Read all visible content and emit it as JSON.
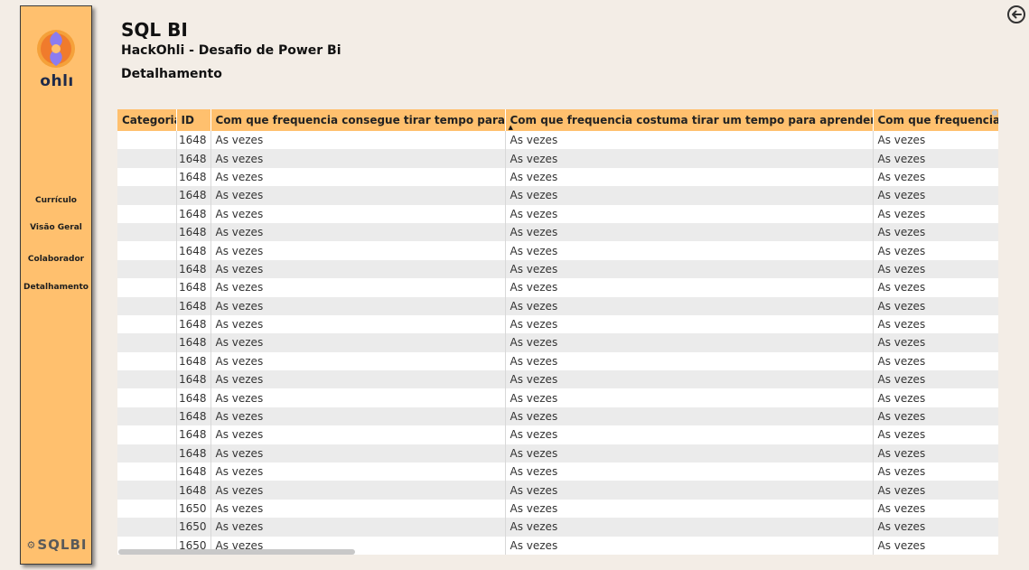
{
  "sidebar": {
    "logo_text": "ohlı",
    "nav": [
      "Currículo",
      "Visão Geral",
      "Colaborador",
      "Detalhamento"
    ],
    "brand": "SQLBI"
  },
  "header": {
    "title": "SQL BI",
    "subtitle": "HackOhli - Desafio de Power Bi",
    "section": "Detalhamento"
  },
  "table": {
    "columns": [
      "Categoria",
      "ID",
      "Com que frequencia consegue tirar tempo para hobbies?",
      "Com que frequencia costuma tirar um tempo para aprender algo novo?",
      "Com que frequencia vo"
    ],
    "rows": [
      [
        "",
        "1648",
        "As vezes",
        "As vezes",
        "As vezes"
      ],
      [
        "",
        "1648",
        "As vezes",
        "As vezes",
        "As vezes"
      ],
      [
        "",
        "1648",
        "As vezes",
        "As vezes",
        "As vezes"
      ],
      [
        "",
        "1648",
        "As vezes",
        "As vezes",
        "As vezes"
      ],
      [
        "",
        "1648",
        "As vezes",
        "As vezes",
        "As vezes"
      ],
      [
        "",
        "1648",
        "As vezes",
        "As vezes",
        "As vezes"
      ],
      [
        "",
        "1648",
        "As vezes",
        "As vezes",
        "As vezes"
      ],
      [
        "",
        "1648",
        "As vezes",
        "As vezes",
        "As vezes"
      ],
      [
        "",
        "1648",
        "As vezes",
        "As vezes",
        "As vezes"
      ],
      [
        "",
        "1648",
        "As vezes",
        "As vezes",
        "As vezes"
      ],
      [
        "",
        "1648",
        "As vezes",
        "As vezes",
        "As vezes"
      ],
      [
        "",
        "1648",
        "As vezes",
        "As vezes",
        "As vezes"
      ],
      [
        "",
        "1648",
        "As vezes",
        "As vezes",
        "As vezes"
      ],
      [
        "",
        "1648",
        "As vezes",
        "As vezes",
        "As vezes"
      ],
      [
        "",
        "1648",
        "As vezes",
        "As vezes",
        "As vezes"
      ],
      [
        "",
        "1648",
        "As vezes",
        "As vezes",
        "As vezes"
      ],
      [
        "",
        "1648",
        "As vezes",
        "As vezes",
        "As vezes"
      ],
      [
        "",
        "1648",
        "As vezes",
        "As vezes",
        "As vezes"
      ],
      [
        "",
        "1648",
        "As vezes",
        "As vezes",
        "As vezes"
      ],
      [
        "",
        "1648",
        "As vezes",
        "As vezes",
        "As vezes"
      ],
      [
        "",
        "1650",
        "As vezes",
        "As vezes",
        "As vezes"
      ],
      [
        "",
        "1650",
        "As vezes",
        "As vezes",
        "As vezes"
      ],
      [
        "",
        "1650",
        "As vezes",
        "As vezes",
        "As vezes"
      ]
    ]
  },
  "colors": {
    "accent": "#ffc06e",
    "background": "#f3ede6",
    "row_alt": "#ebebeb"
  },
  "icons": {
    "back": "back-arrow-icon",
    "logo": "ohli-logo-icon",
    "sort": "sort-ascending-icon"
  }
}
